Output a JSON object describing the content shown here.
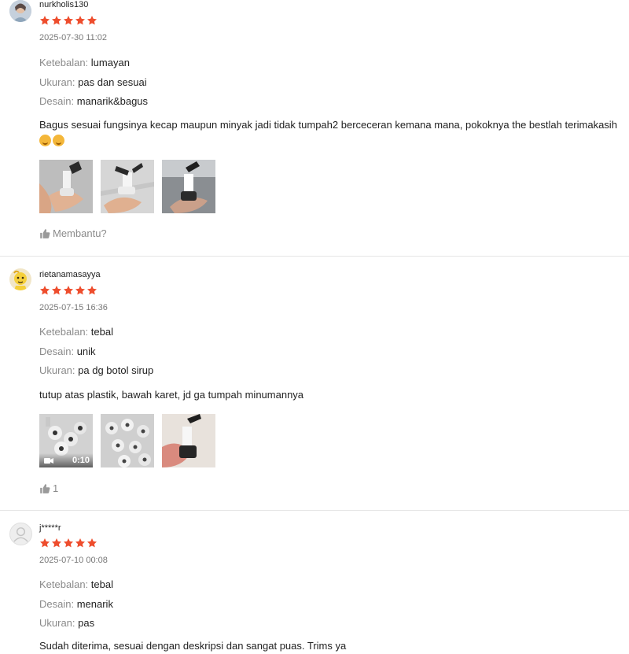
{
  "reviews": [
    {
      "username": "nurkholis130",
      "rating": 5,
      "date": "2025-07-30 11:02",
      "attributes": [
        {
          "key": "Ketebalan: ",
          "value": "lumayan"
        },
        {
          "key": "Ukuran: ",
          "value": "pas dan sesuai"
        },
        {
          "key": "Desain: ",
          "value": "manarik&bagus"
        }
      ],
      "text": "Bagus sesuai fungsinya kecap maupun minyak jadi tidak tumpah2 berceceran kemana mana, pokoknya the bestlah terimakasih",
      "helpful": "Membantu?"
    },
    {
      "username": "rietanamasayya",
      "rating": 5,
      "date": "2025-07-15 16:36",
      "attributes": [
        {
          "key": "Ketebalan: ",
          "value": "tebal"
        },
        {
          "key": "Desain: ",
          "value": "unik"
        },
        {
          "key": "Ukuran: ",
          "value": "pa dg botol sirup"
        }
      ],
      "text": "tutup atas plastik, bawah karet, jd ga tumpah minumannya",
      "video_duration": "0:10",
      "helpful": "1"
    },
    {
      "username": "j*****r",
      "rating": 5,
      "date": "2025-07-10 00:08",
      "attributes": [
        {
          "key": "Ketebalan: ",
          "value": "tebal"
        },
        {
          "key": "Desain: ",
          "value": "menarik"
        },
        {
          "key": "Ukuran: ",
          "value": "pas"
        }
      ],
      "text": "Sudah diterima, sesuai dengan deskripsi dan sangat puas. Trims ya"
    }
  ],
  "colors": {
    "star": "#ee4d2d",
    "muted": "#8a8a8a",
    "divider": "#e6e6e6"
  },
  "icons": [
    "avatar-icon",
    "star-icon",
    "thumbs-up-icon",
    "video-camera-icon",
    "hug-emoji-icon"
  ]
}
